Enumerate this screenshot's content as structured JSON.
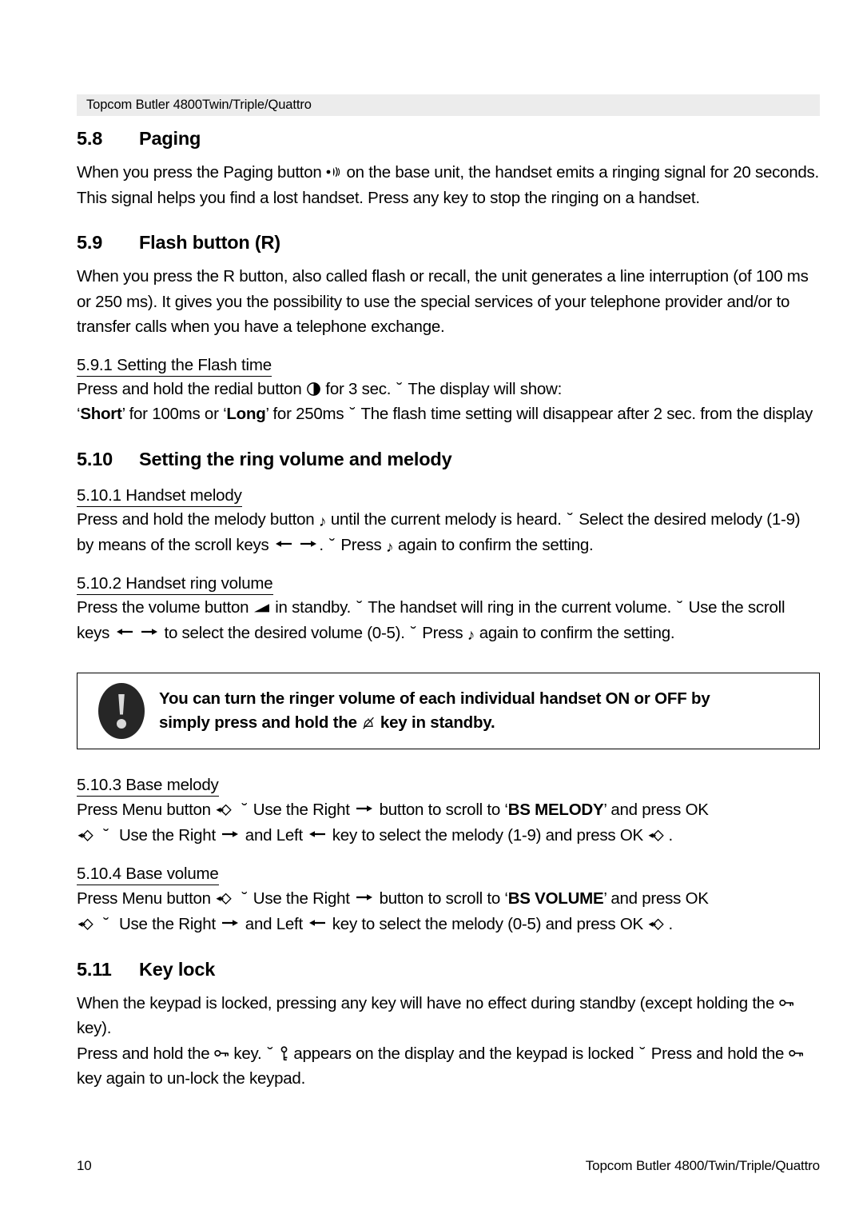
{
  "header": {
    "running_title": "Topcom Butler 4800Twin/Triple/Quattro"
  },
  "sections": {
    "paging": {
      "number": "5.8",
      "title": "Paging",
      "text_part1": "When you press the Paging button",
      "text_part2": "on the base unit, the handset emits a ringing signal for 20 seconds. This signal helps you find a lost handset. Press any key to stop the ringing on a handset."
    },
    "flash": {
      "number": "5.9",
      "title": "Flash button (R)",
      "paragraph": "When you press the R button, also called flash or recall, the unit generates a line interruption (of 100 ms or 250 ms). It gives you the possibility to use the special services of your telephone provider and/or to transfer calls when you have a telephone exchange.",
      "sub1": {
        "heading": "5.9.1 Setting the Flash time",
        "line1_part1": "Press and hold the redial button",
        "line1_part2": "for 3 sec.",
        "line1_part3": "The display will show:",
        "line2_pre": "‘",
        "line2_bold1": "Short",
        "line2_mid": "’ for 100ms or ‘",
        "line2_bold2": "Long",
        "line2_post": "’ for 250ms",
        "line2_tail": "The flash time setting will disappear after 2 sec. from the display"
      }
    },
    "ring_volume_melody": {
      "number": "5.10",
      "title": "Setting the ring volume and melody",
      "sub1": {
        "heading": "5.10.1 Handset melody",
        "part1": "Press and hold the melody button",
        "part2": "until the current melody is heard.",
        "part3": "Select the desired melody (1-9) by means of the scroll keys",
        "part4": ".",
        "part5": "Press",
        "part6": "again to confirm the setting."
      },
      "sub2": {
        "heading": "5.10.2 Handset ring volume",
        "part1": "Press the volume button",
        "part2": "in standby.",
        "part3": "The handset will ring in the current volume.",
        "part4": "Use the scroll keys",
        "part5": "to select the desired volume (0-5).",
        "part6": "Press",
        "part7": "again to confirm the setting."
      },
      "note": {
        "line1": "You can turn the ringer volume of each individual handset ON or OFF by",
        "line2_part1": "simply press and hold the",
        "line2_part2": "key in standby."
      },
      "sub3": {
        "heading": "5.10.3 Base melody",
        "part1": "Press Menu button",
        "part2": "Use the Right",
        "part3": "button to scroll to ‘",
        "bold": "BS MELODY",
        "part4": "’ and press OK",
        "part5": "Use the Right",
        "part6": "and Left",
        "part7": "key to select the melody (1-9) and press OK",
        "part8": "."
      },
      "sub4": {
        "heading": "5.10.4 Base volume",
        "part1": "Press Menu button",
        "part2": "Use the Right",
        "part3": "button to scroll to ‘",
        "bold": "BS VOLUME",
        "part4": "’ and press OK",
        "part5": "Use the Right",
        "part6": "and Left",
        "part7": "key to select the melody (0-5) and press OK",
        "part8": "."
      }
    },
    "key_lock": {
      "number": "5.11",
      "title": "Key lock",
      "p1_part1": "When the keypad is locked, pressing any key will have no effect during standby (except holding the",
      "p1_part2": "key).",
      "p2_part1": "Press and hold the",
      "p2_part2": "key.",
      "p2_part3": "appears on the display and the keypad is locked",
      "p2_part4": "Press and hold the",
      "p2_part5": "key again to un-lock the keypad."
    }
  },
  "separator_glyph": "˘",
  "icons": {
    "paging": "paging-speaker-icon",
    "redial": "redial-icon",
    "melody": "music-note-icon",
    "volume": "volume-wedge-icon",
    "arrow_left": "arrow-left-icon",
    "arrow_right": "arrow-right-icon",
    "menu": "menu-ok-icon",
    "bell_off": "bell-off-icon",
    "key": "key-icon",
    "key_display": "key-lock-display-icon",
    "note_badge": "exclamation-badge-icon"
  },
  "footer": {
    "page_number": "10",
    "product": "Topcom Butler 4800/Twin/Triple/Quattro"
  },
  "colors": {
    "header_bar_bg": "#ececec",
    "text": "#000000",
    "badge_bg": "#262626",
    "badge_glyph": "#d9d9d9",
    "page_bg": "#ffffff"
  }
}
